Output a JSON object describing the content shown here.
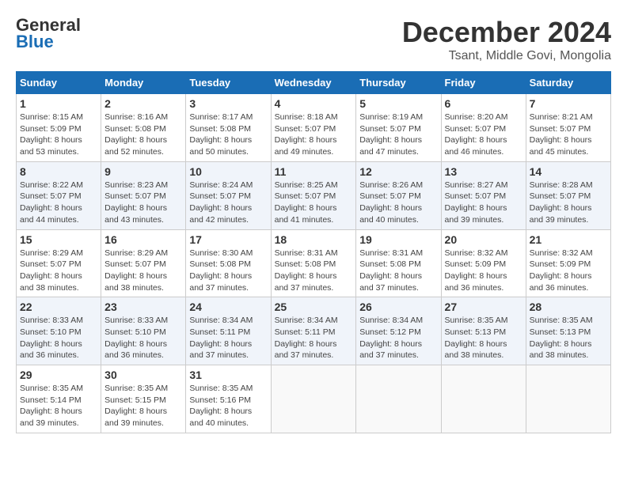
{
  "header": {
    "logo_line1": "General",
    "logo_line2": "Blue",
    "month": "December 2024",
    "location": "Tsant, Middle Govi, Mongolia"
  },
  "days_of_week": [
    "Sunday",
    "Monday",
    "Tuesday",
    "Wednesday",
    "Thursday",
    "Friday",
    "Saturday"
  ],
  "weeks": [
    [
      {
        "day": 1,
        "sunrise": "8:15 AM",
        "sunset": "5:09 PM",
        "daylight": "8 hours and 53 minutes."
      },
      {
        "day": 2,
        "sunrise": "8:16 AM",
        "sunset": "5:08 PM",
        "daylight": "8 hours and 52 minutes."
      },
      {
        "day": 3,
        "sunrise": "8:17 AM",
        "sunset": "5:08 PM",
        "daylight": "8 hours and 50 minutes."
      },
      {
        "day": 4,
        "sunrise": "8:18 AM",
        "sunset": "5:07 PM",
        "daylight": "8 hours and 49 minutes."
      },
      {
        "day": 5,
        "sunrise": "8:19 AM",
        "sunset": "5:07 PM",
        "daylight": "8 hours and 47 minutes."
      },
      {
        "day": 6,
        "sunrise": "8:20 AM",
        "sunset": "5:07 PM",
        "daylight": "8 hours and 46 minutes."
      },
      {
        "day": 7,
        "sunrise": "8:21 AM",
        "sunset": "5:07 PM",
        "daylight": "8 hours and 45 minutes."
      }
    ],
    [
      {
        "day": 8,
        "sunrise": "8:22 AM",
        "sunset": "5:07 PM",
        "daylight": "8 hours and 44 minutes."
      },
      {
        "day": 9,
        "sunrise": "8:23 AM",
        "sunset": "5:07 PM",
        "daylight": "8 hours and 43 minutes."
      },
      {
        "day": 10,
        "sunrise": "8:24 AM",
        "sunset": "5:07 PM",
        "daylight": "8 hours and 42 minutes."
      },
      {
        "day": 11,
        "sunrise": "8:25 AM",
        "sunset": "5:07 PM",
        "daylight": "8 hours and 41 minutes."
      },
      {
        "day": 12,
        "sunrise": "8:26 AM",
        "sunset": "5:07 PM",
        "daylight": "8 hours and 40 minutes."
      },
      {
        "day": 13,
        "sunrise": "8:27 AM",
        "sunset": "5:07 PM",
        "daylight": "8 hours and 39 minutes."
      },
      {
        "day": 14,
        "sunrise": "8:28 AM",
        "sunset": "5:07 PM",
        "daylight": "8 hours and 39 minutes."
      }
    ],
    [
      {
        "day": 15,
        "sunrise": "8:29 AM",
        "sunset": "5:07 PM",
        "daylight": "8 hours and 38 minutes."
      },
      {
        "day": 16,
        "sunrise": "8:29 AM",
        "sunset": "5:07 PM",
        "daylight": "8 hours and 38 minutes."
      },
      {
        "day": 17,
        "sunrise": "8:30 AM",
        "sunset": "5:08 PM",
        "daylight": "8 hours and 37 minutes."
      },
      {
        "day": 18,
        "sunrise": "8:31 AM",
        "sunset": "5:08 PM",
        "daylight": "8 hours and 37 minutes."
      },
      {
        "day": 19,
        "sunrise": "8:31 AM",
        "sunset": "5:08 PM",
        "daylight": "8 hours and 37 minutes."
      },
      {
        "day": 20,
        "sunrise": "8:32 AM",
        "sunset": "5:09 PM",
        "daylight": "8 hours and 36 minutes."
      },
      {
        "day": 21,
        "sunrise": "8:32 AM",
        "sunset": "5:09 PM",
        "daylight": "8 hours and 36 minutes."
      }
    ],
    [
      {
        "day": 22,
        "sunrise": "8:33 AM",
        "sunset": "5:10 PM",
        "daylight": "8 hours and 36 minutes."
      },
      {
        "day": 23,
        "sunrise": "8:33 AM",
        "sunset": "5:10 PM",
        "daylight": "8 hours and 36 minutes."
      },
      {
        "day": 24,
        "sunrise": "8:34 AM",
        "sunset": "5:11 PM",
        "daylight": "8 hours and 37 minutes."
      },
      {
        "day": 25,
        "sunrise": "8:34 AM",
        "sunset": "5:11 PM",
        "daylight": "8 hours and 37 minutes."
      },
      {
        "day": 26,
        "sunrise": "8:34 AM",
        "sunset": "5:12 PM",
        "daylight": "8 hours and 37 minutes."
      },
      {
        "day": 27,
        "sunrise": "8:35 AM",
        "sunset": "5:13 PM",
        "daylight": "8 hours and 38 minutes."
      },
      {
        "day": 28,
        "sunrise": "8:35 AM",
        "sunset": "5:13 PM",
        "daylight": "8 hours and 38 minutes."
      }
    ],
    [
      {
        "day": 29,
        "sunrise": "8:35 AM",
        "sunset": "5:14 PM",
        "daylight": "8 hours and 39 minutes."
      },
      {
        "day": 30,
        "sunrise": "8:35 AM",
        "sunset": "5:15 PM",
        "daylight": "8 hours and 39 minutes."
      },
      {
        "day": 31,
        "sunrise": "8:35 AM",
        "sunset": "5:16 PM",
        "daylight": "8 hours and 40 minutes."
      },
      null,
      null,
      null,
      null
    ]
  ]
}
